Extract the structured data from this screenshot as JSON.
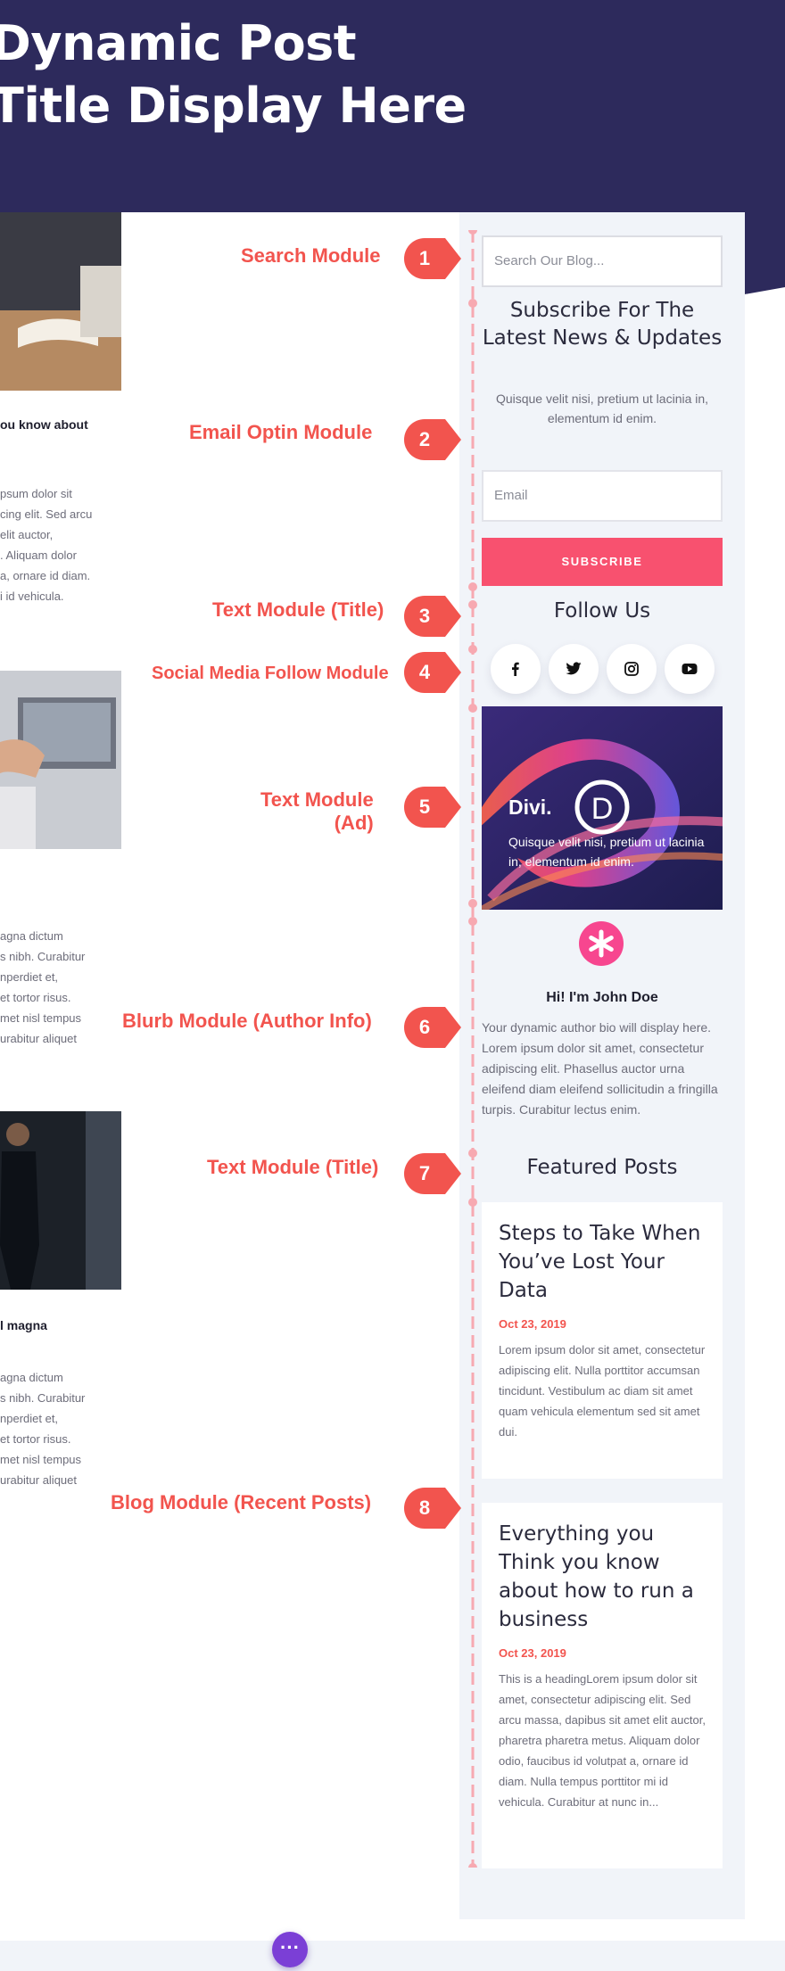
{
  "header": {
    "title": "Dynamic Post Title Display Here"
  },
  "left_posts": [
    {
      "title": "ou know about",
      "excerpt": [
        "psum dolor sit",
        "cing elit. Sed arcu",
        "elit auctor,",
        ". Aliquam dolor",
        "a, ornare id diam.",
        "i id vehicula."
      ]
    },
    {
      "title": "",
      "excerpt": [
        "agna dictum",
        "s nibh. Curabitur",
        "nperdiet et,",
        "et tortor risus.",
        "met nisl tempus",
        "urabitur aliquet"
      ]
    },
    {
      "title": "l magna",
      "excerpt": [
        "agna dictum",
        "s nibh. Curabitur",
        "nperdiet et,",
        "et tortor risus.",
        "met nisl tempus",
        "urabitur aliquet"
      ]
    }
  ],
  "annotations": [
    {
      "number": "1",
      "label": "Search Module"
    },
    {
      "number": "2",
      "label": "Email Optin Module"
    },
    {
      "number": "3",
      "label": "Text Module (Title)"
    },
    {
      "number": "4",
      "label": "Social Media Follow Module"
    },
    {
      "number": "5",
      "label_line1": "Text Module",
      "label_line2": "(Ad)"
    },
    {
      "number": "6",
      "label": "Blurb Module (Author Info)"
    },
    {
      "number": "7",
      "label": "Text Module (Title)"
    },
    {
      "number": "8",
      "label": "Blog Module (Recent Posts)"
    }
  ],
  "sidebar": {
    "search": {
      "placeholder": "Search Our Blog..."
    },
    "optin": {
      "title": "Subscribe For The Latest News & Updates",
      "text": "Quisque velit nisi, pretium ut lacinia in, elementum id enim.",
      "email_placeholder": "Email",
      "button": "SUBSCRIBE"
    },
    "follow": {
      "title": "Follow Us",
      "networks": [
        "facebook-icon",
        "twitter-icon",
        "instagram-icon",
        "youtube-icon"
      ]
    },
    "ad": {
      "brand": "Divi.",
      "text": "Quisque velit nisi, pretium ut lacinia in, elementum id enim."
    },
    "author": {
      "name": "Hi! I'm John Doe",
      "bio": "Your dynamic author bio will display here. Lorem ipsum dolor sit amet, consectetur adipiscing elit. Phasellus auctor urna eleifend diam eleifend sollicitudin a fringilla turpis. Curabitur lectus enim."
    },
    "featured": {
      "title": "Featured Posts",
      "posts": [
        {
          "title": "Steps to Take When You’ve Lost Your Data",
          "date": "Oct 23, 2019",
          "excerpt": "Lorem ipsum dolor sit amet, consectetur adipiscing elit. Nulla porttitor accumsan tincidunt. Vestibulum ac diam sit amet quam vehicula elementum sed sit amet dui."
        },
        {
          "title": "Everything you Think you know about how to run a business",
          "date": "Oct 23, 2019",
          "excerpt": "This is a headingLorem ipsum dolor sit amet, consectetur adipiscing elit. Sed arcu massa, dapibus sit amet elit auctor, pharetra pharetra metus. Aliquam dolor odio, faucibus id volutpat a, ornare id diam. Nulla tempus porttitor mi id vehicula. Curabitur at nunc in..."
        }
      ]
    }
  },
  "colors": {
    "hero": "#2d2a5c",
    "accent": "#f2544e",
    "subscribe": "#f8516f",
    "sidebar_bg": "#f1f4f9",
    "fab": "#7b3fd6"
  },
  "fab_label": "···"
}
